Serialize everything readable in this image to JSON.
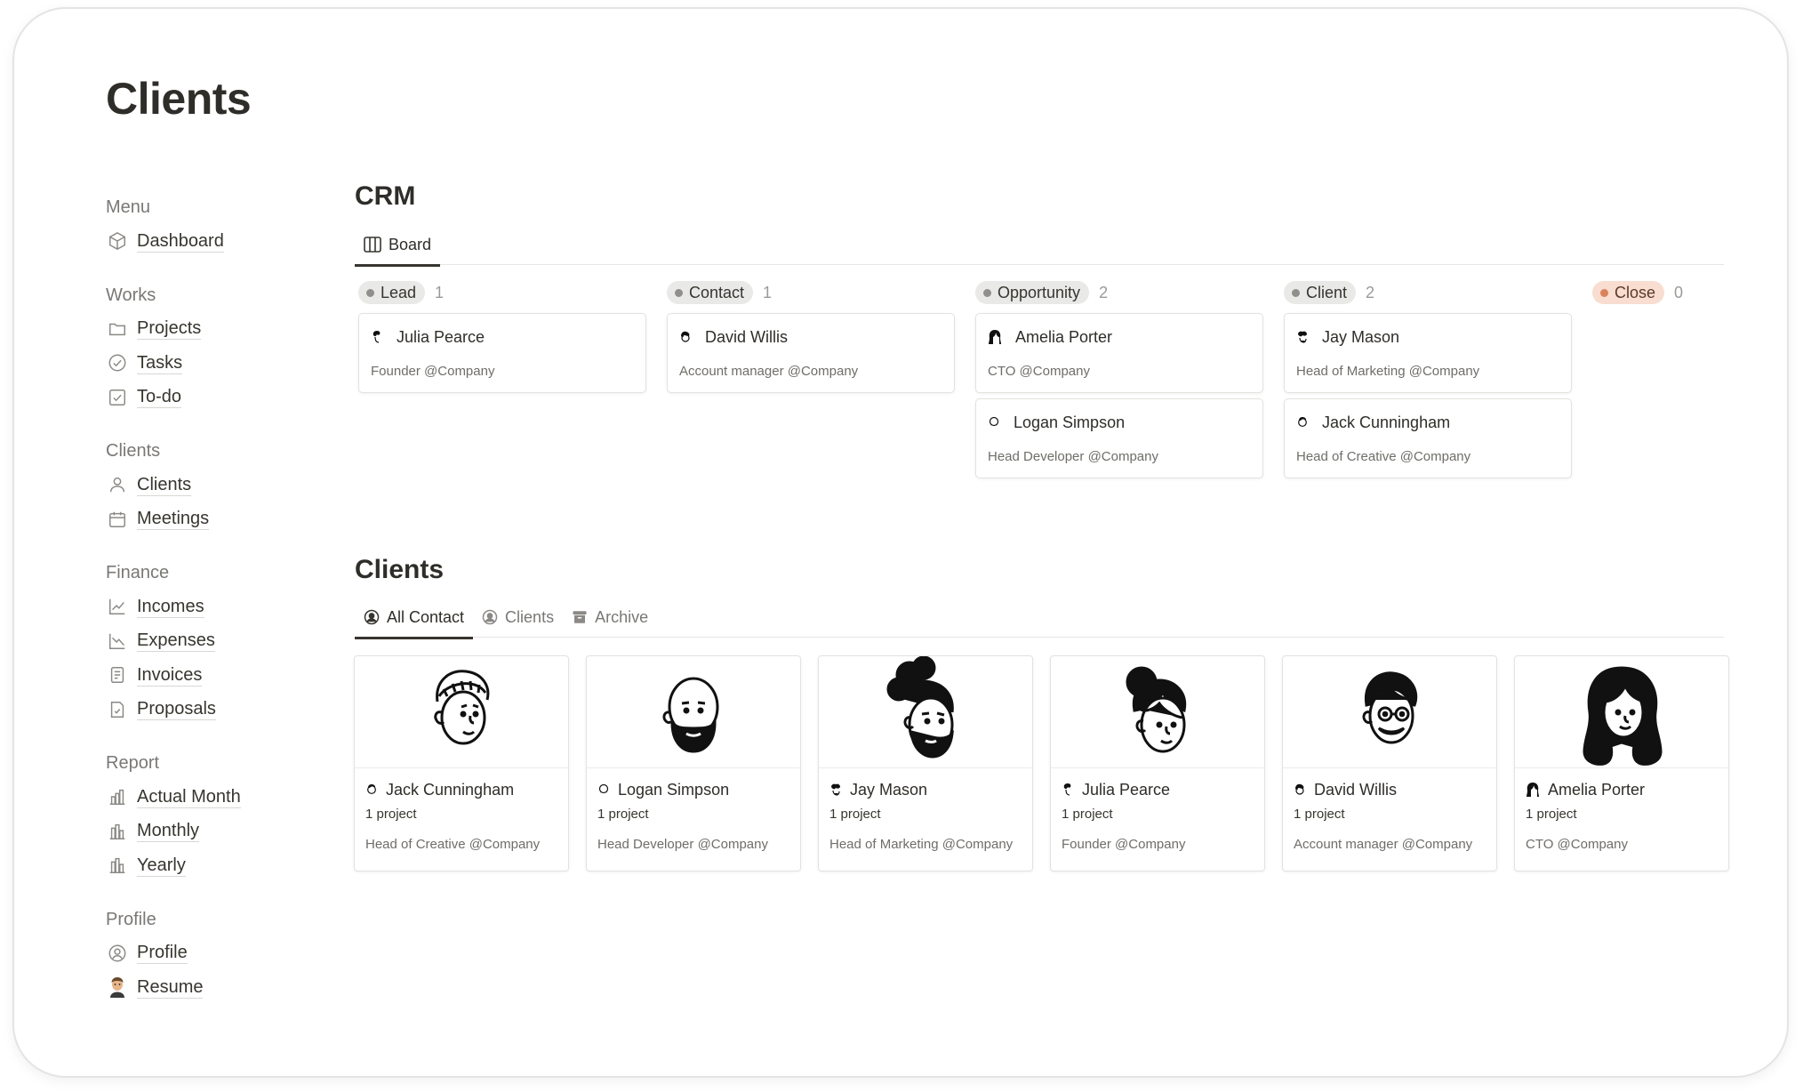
{
  "page": {
    "title": "Clients"
  },
  "sidebar": {
    "groups": [
      {
        "heading": "Menu",
        "items": [
          {
            "label": "Dashboard",
            "icon": "cube-icon"
          }
        ]
      },
      {
        "heading": "Works",
        "items": [
          {
            "label": "Projects",
            "icon": "folder-icon"
          },
          {
            "label": "Tasks",
            "icon": "check-circle-icon"
          },
          {
            "label": "To-do",
            "icon": "checkbox-icon"
          }
        ]
      },
      {
        "heading": "Clients",
        "items": [
          {
            "label": "Clients",
            "icon": "person-icon"
          },
          {
            "label": "Meetings",
            "icon": "calendar-icon"
          }
        ]
      },
      {
        "heading": "Finance",
        "items": [
          {
            "label": "Incomes",
            "icon": "trend-up-icon"
          },
          {
            "label": "Expenses",
            "icon": "trend-down-icon"
          },
          {
            "label": "Invoices",
            "icon": "document-icon"
          },
          {
            "label": "Proposals",
            "icon": "document-check-icon"
          }
        ]
      },
      {
        "heading": "Report",
        "items": [
          {
            "label": "Actual Month",
            "icon": "bar-chart-icon"
          },
          {
            "label": "Monthly",
            "icon": "bar-chart-icon"
          },
          {
            "label": "Yearly",
            "icon": "bar-chart-icon"
          }
        ]
      },
      {
        "heading": "Profile",
        "items": [
          {
            "label": "Profile",
            "icon": "user-circle-icon"
          },
          {
            "label": "Resume",
            "icon": "avatar-emoji-icon"
          }
        ]
      }
    ]
  },
  "crm": {
    "title": "CRM",
    "tab": "Board",
    "columns": [
      {
        "name": "Lead",
        "count": "1",
        "cards": [
          {
            "name": "Julia Pearce",
            "role": "Founder @Company"
          }
        ]
      },
      {
        "name": "Contact",
        "count": "1",
        "cards": [
          {
            "name": "David Willis",
            "role": "Account manager @Company"
          }
        ]
      },
      {
        "name": "Opportunity",
        "count": "2",
        "cards": [
          {
            "name": "Amelia Porter",
            "role": "CTO @Company"
          },
          {
            "name": "Logan Simpson",
            "role": "Head Developer @Company"
          }
        ]
      },
      {
        "name": "Client",
        "count": "2",
        "cards": [
          {
            "name": "Jay Mason",
            "role": "Head of Marketing @Company"
          },
          {
            "name": "Jack Cunningham",
            "role": "Head of Creative @Company"
          }
        ]
      },
      {
        "name": "Close",
        "count": "0",
        "cards": []
      }
    ]
  },
  "clients": {
    "title": "Clients",
    "tabs": [
      "All Contact",
      "Clients",
      "Archive"
    ],
    "cards": [
      {
        "name": "Jack Cunningham",
        "projects": "1 project",
        "role": "Head of Creative @Company"
      },
      {
        "name": "Logan Simpson",
        "projects": "1 project",
        "role": "Head Developer @Company"
      },
      {
        "name": "Jay Mason",
        "projects": "1 project",
        "role": "Head of Marketing @Company"
      },
      {
        "name": "Julia Pearce",
        "projects": "1 project",
        "role": "Founder @Company"
      },
      {
        "name": "David Willis",
        "projects": "1 project",
        "role": "Account manager @Company"
      },
      {
        "name": "Amelia Porter",
        "projects": "1 project",
        "role": "CTO @Company"
      }
    ]
  }
}
